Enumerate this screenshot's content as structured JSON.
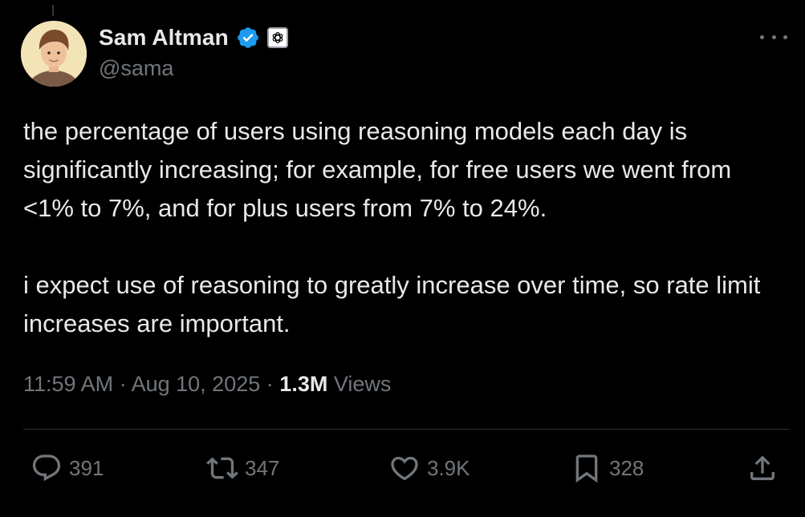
{
  "author": {
    "display_name": "Sam Altman",
    "handle": "@sama",
    "verified": true,
    "affiliate_badge": "openai-logo-icon"
  },
  "tweet": {
    "paragraphs": [
      "the percentage of users using reasoning models each day is significantly increasing; for example, for free users we went from <1% to 7%, and for plus users from 7% to 24%.",
      "i expect use of reasoning to greatly increase over time, so rate limit increases are important."
    ]
  },
  "meta": {
    "time": "11:59 AM",
    "separator": "·",
    "date": "Aug 10, 2025",
    "views_count": "1.3M",
    "views_label": "Views"
  },
  "actions": {
    "replies": "391",
    "reposts": "347",
    "likes": "3.9K",
    "bookmarks": "328"
  },
  "colors": {
    "background": "#000000",
    "text": "#e7e9ea",
    "muted": "#71767b",
    "verified": "#1d9bf0",
    "divider": "#2f3336"
  }
}
